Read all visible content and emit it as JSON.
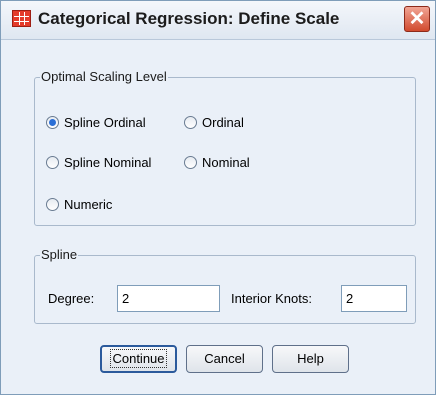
{
  "window": {
    "title": "Categorical Regression: Define Scale",
    "icon": "dialog-app-icon",
    "close_glyph": "✕"
  },
  "optimal_scaling": {
    "legend": "Optimal Scaling Level",
    "options": [
      {
        "label": "Spline Ordinal",
        "checked": true
      },
      {
        "label": "Ordinal",
        "checked": false
      },
      {
        "label": "Spline Nominal",
        "checked": false
      },
      {
        "label": "Nominal",
        "checked": false
      },
      {
        "label": "Numeric",
        "checked": false
      }
    ]
  },
  "spline": {
    "legend": "Spline",
    "degree_label": "Degree:",
    "degree_value": "2",
    "knots_label": "Interior Knots:",
    "knots_value": "2"
  },
  "buttons": {
    "continue": "Continue",
    "cancel": "Cancel",
    "help": "Help"
  }
}
